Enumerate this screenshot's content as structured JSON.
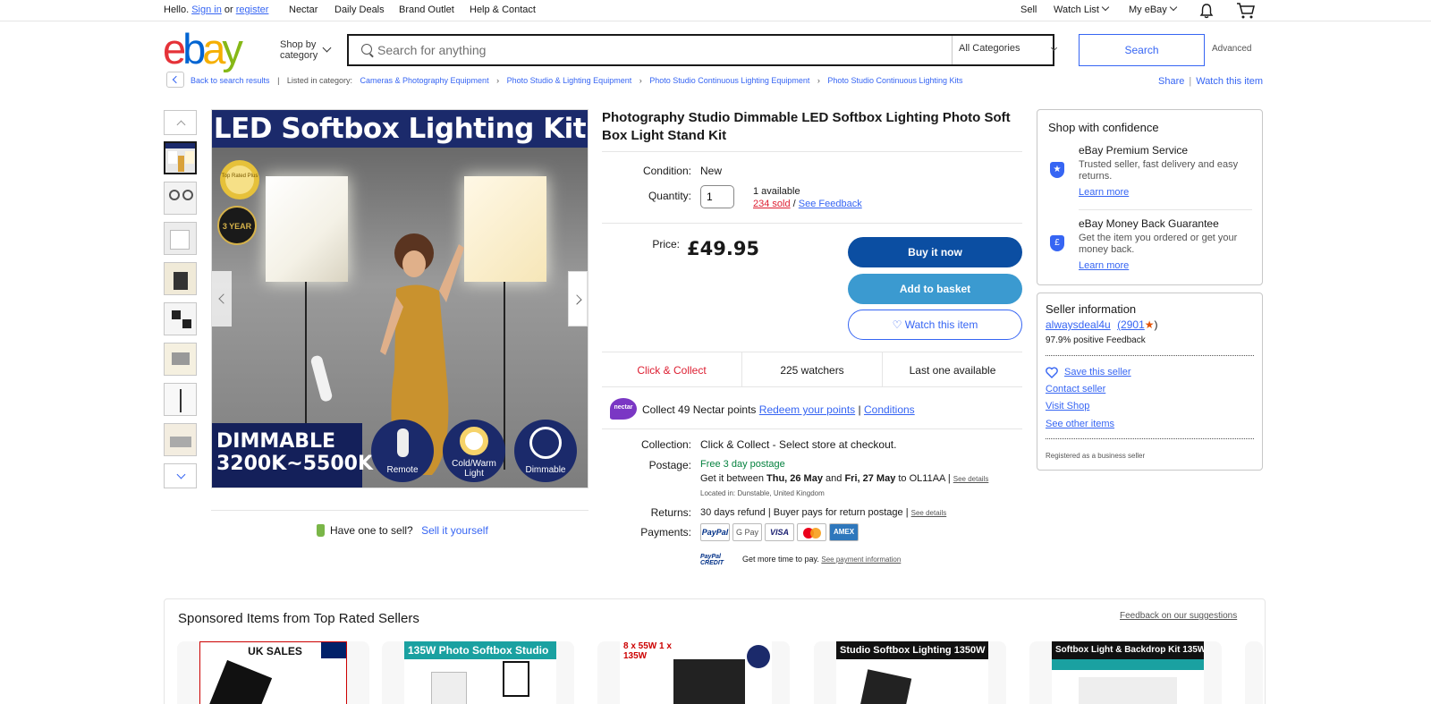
{
  "topbar": {
    "hello": "Hello.",
    "sign_in": "Sign in",
    "or": "or",
    "register": "register",
    "links": [
      "Nectar",
      "Daily Deals",
      "Brand Outlet",
      "Help & Contact"
    ],
    "sell": "Sell",
    "watch_list": "Watch List",
    "my_ebay": "My eBay"
  },
  "header": {
    "logo_letters": [
      "e",
      "b",
      "a",
      "y"
    ],
    "logo_colors": [
      "#e53238",
      "#0064d2",
      "#f5af02",
      "#86b817"
    ],
    "shop_by": "Shop by",
    "category": "category",
    "search_placeholder": "Search for anything",
    "category_select": "All Categories",
    "search_button": "Search",
    "advanced": "Advanced"
  },
  "breadcrumb": {
    "back": "Back to search results",
    "listed_in": "Listed in category:",
    "items": [
      "Cameras & Photography Equipment",
      "Photo Studio & Lighting Equipment",
      "Photo Studio Continuous Lighting Equipment",
      "Photo Studio Continuous Lighting Kits"
    ],
    "share": "Share",
    "watch_item": "Watch this item"
  },
  "image": {
    "banner": "LED Softbox Lighting Kit",
    "dimmable_line1": "DIMMABLE",
    "dimmable_line2": "3200K~5500K",
    "features": [
      "Remote",
      "Cold/Warm Light",
      "Dimmable"
    ],
    "badge_top": "Top Rated Plus",
    "badge_year": "3 YEAR"
  },
  "sell_row": {
    "question": "Have one to sell?",
    "link": "Sell it yourself"
  },
  "product": {
    "title": "Photography Studio Dimmable LED Softbox Lighting Photo Soft Box Light Stand Kit",
    "condition_label": "Condition:",
    "condition": "New",
    "quantity_label": "Quantity:",
    "quantity": "1",
    "available": "1 available",
    "sold": "234 sold",
    "slash": "/",
    "see_feedback": "See Feedback",
    "price_label": "Price:",
    "price": "£49.95",
    "buy_now": "Buy it now",
    "add_basket": "Add to basket",
    "watch": "♡ Watch this item",
    "stats": [
      "Click & Collect",
      "225 watchers",
      "Last one available"
    ],
    "nectar_logo": "nectar",
    "nectar_collect": "Collect",
    "nectar_points": "49",
    "nectar_text": "Nectar points",
    "redeem": "Redeem your points",
    "conditions": "Conditions",
    "collection_label": "Collection:",
    "collection": "Click & Collect - Select store at checkout.",
    "postage_label": "Postage:",
    "postage_free": "Free 3 day postage",
    "postage_between": "Get it between",
    "date1": "Thu, 26 May",
    "and": "and",
    "date2": "Fri, 27 May",
    "to": "to OL11AA",
    "see_details": "See details",
    "located": "Located in: Dunstable, United Kingdom",
    "returns_label": "Returns:",
    "returns": "30 days refund | Buyer pays for return postage |",
    "payments_label": "Payments:",
    "payment_methods": [
      "PayPal",
      "G Pay",
      "VISA",
      "MC",
      "AMEX"
    ],
    "paypal_credit": "PayPal CREDIT",
    "more_time": "Get more time to pay.",
    "see_payment": "See payment information"
  },
  "confidence": {
    "title": "Shop with confidence",
    "premium_title": "eBay Premium Service",
    "premium_desc": "Trusted seller, fast delivery and easy returns.",
    "learn_more": "Learn more",
    "mbg_title": "eBay Money Back Guarantee",
    "mbg_desc": "Get the item you ordered or get your money back."
  },
  "seller": {
    "title": "Seller information",
    "name": "alwaysdeal4u",
    "score": "(2901",
    "score_close": ")",
    "positive": "97.9% positive Feedback",
    "save": "Save this seller",
    "contact": "Contact seller",
    "visit": "Visit Shop",
    "other": "See other items",
    "business": "Registered as a business seller"
  },
  "sponsored": {
    "title": "Sponsored Items from Top Rated Sellers",
    "feedback": "Feedback on our suggestions",
    "cards": [
      {
        "banner": "UK SALES",
        "color": "#ffffff"
      },
      {
        "banner": "135W Photo Softbox Studio",
        "color": "#1aa1a1"
      },
      {
        "banner": "8 x 55W  1 x 135W",
        "color": "#ffffff"
      },
      {
        "banner": "Studio Softbox Lighting 1350W",
        "color": "#111111"
      },
      {
        "banner": "Softbox Light & Backdrop Kit 135W",
        "color": "#111111"
      }
    ]
  }
}
